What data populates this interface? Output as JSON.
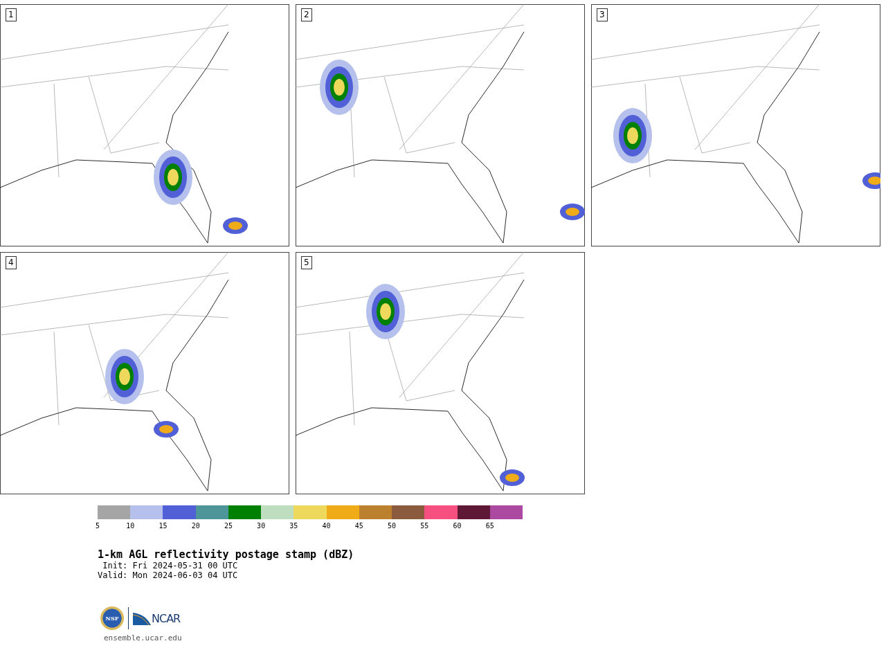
{
  "panels": [
    {
      "label": "1"
    },
    {
      "label": "2"
    },
    {
      "label": "3"
    },
    {
      "label": "4"
    },
    {
      "label": "5"
    }
  ],
  "colorbar": {
    "segments": [
      {
        "color": "#a5a5a5"
      },
      {
        "color": "#b5c1ec"
      },
      {
        "color": "#5160d6"
      },
      {
        "color": "#4e9699"
      },
      {
        "color": "#008000"
      },
      {
        "color": "#bfddbf"
      },
      {
        "color": "#efd95d"
      },
      {
        "color": "#f0ac18"
      },
      {
        "color": "#bb812f"
      },
      {
        "color": "#8b5b3e"
      },
      {
        "color": "#f5507f"
      },
      {
        "color": "#5f1836"
      },
      {
        "color": "#ac4aa2"
      }
    ],
    "ticks": [
      "5",
      "10",
      "15",
      "20",
      "25",
      "30",
      "35",
      "40",
      "45",
      "50",
      "55",
      "60",
      "65"
    ]
  },
  "title": "1-km AGL reflectivity postage stamp (dBZ)",
  "init": " Init: Fri 2024-05-31 00 UTC",
  "valid": "Valid: Mon 2024-06-03 04 UTC",
  "logo": {
    "left": "NSF",
    "right": "NCAR"
  },
  "url": "ensemble.ucar.edu"
}
